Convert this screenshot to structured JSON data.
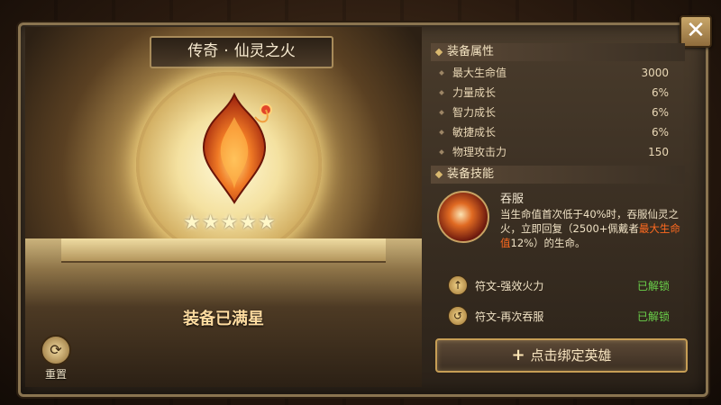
{
  "item": {
    "rarity": "传奇",
    "name": "仙灵之火",
    "max_star_text": "装备已满星",
    "stars": 5
  },
  "reset": {
    "label": "重置"
  },
  "attributes": {
    "title": "装备属性",
    "rows": [
      {
        "name": "最大生命值",
        "value": "3000"
      },
      {
        "name": "力量成长",
        "value": "6%"
      },
      {
        "name": "智力成长",
        "value": "6%"
      },
      {
        "name": "敏捷成长",
        "value": "6%"
      },
      {
        "name": "物理攻击力",
        "value": "150"
      }
    ]
  },
  "skill": {
    "title": "装备技能",
    "name": "吞服",
    "desc_part1": "当生命值首次低于40%时，吞服仙灵之火，立即回复（2500+佩戴者",
    "desc_highlight": "最大生命值",
    "desc_part2": "12%）的生命。"
  },
  "runes": [
    {
      "name": "符文-强效火力",
      "status": "已解锁"
    },
    {
      "name": "符文-再次吞服",
      "status": "已解锁"
    }
  ],
  "bind_button": {
    "label": "点击绑定英雄"
  },
  "colors": {
    "unlocked": "#6ad14a",
    "highlight": "#ff6a1f",
    "gold": "#c79e55"
  }
}
